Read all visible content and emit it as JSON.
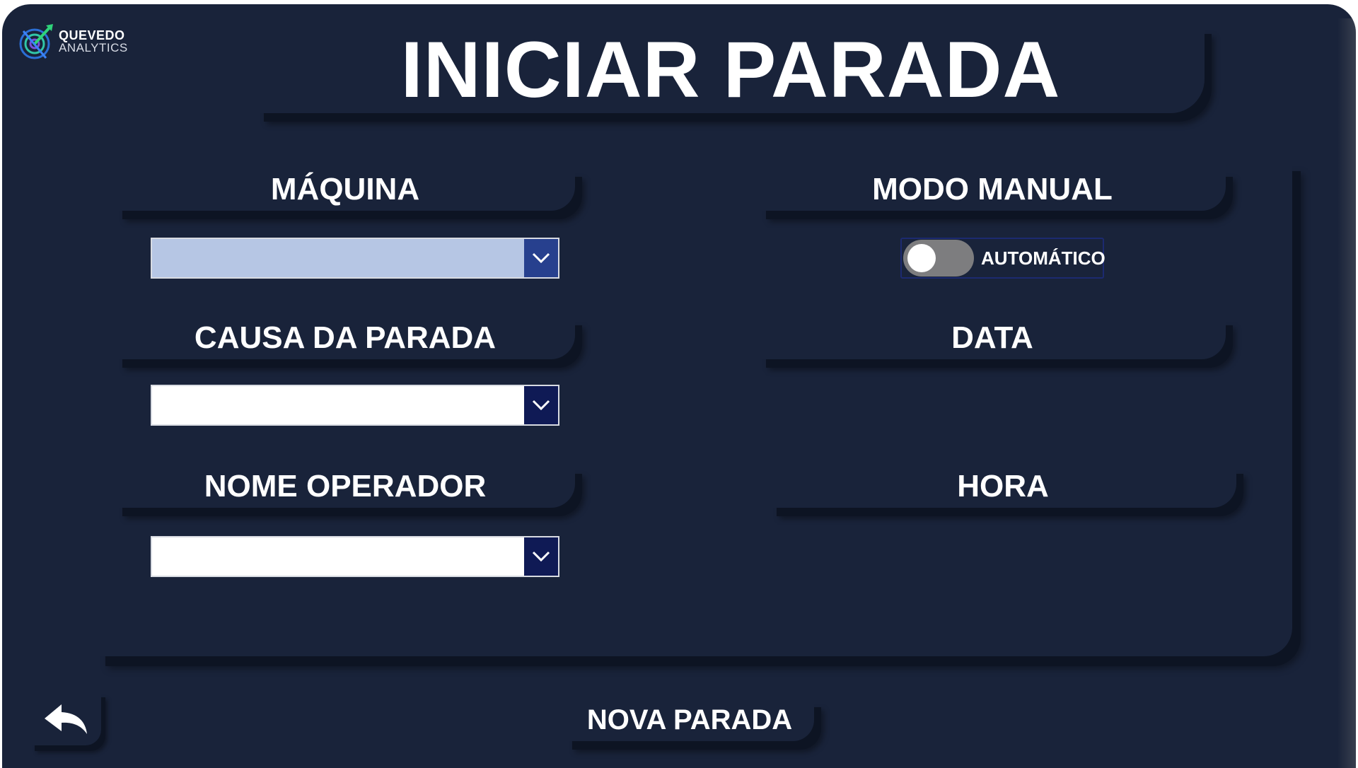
{
  "logo": {
    "name": "QUEVEDO",
    "subtitle": "ANALYTICS",
    "icon": "quevedo-analytics-logo"
  },
  "title": "INICIAR PARADA",
  "fields": {
    "maquina": {
      "label": "MÁQUINA",
      "value": "",
      "icon": "chevron-down-icon"
    },
    "causa": {
      "label": "CAUSA DA PARADA",
      "value": "",
      "icon": "chevron-down-icon"
    },
    "operador": {
      "label": "NOME OPERADOR",
      "value": "",
      "icon": "chevron-down-icon"
    },
    "modo": {
      "label": "MODO MANUAL",
      "toggle_label": "AUTOMÁTICO",
      "toggle_on": false
    },
    "data": {
      "label": "DATA",
      "value": ""
    },
    "hora": {
      "label": "HORA",
      "value": ""
    }
  },
  "actions": {
    "nova_parada": "NOVA PARADA",
    "back_icon": "back-arrow-icon"
  },
  "colors": {
    "background": "#19233a",
    "shadow": "#0d1423",
    "dropdown_arrow": "#0f1a55",
    "dropdown_selected_bg": "#b6c6e4",
    "toggle_off": "#7d7d7f",
    "text": "#ffffff"
  }
}
